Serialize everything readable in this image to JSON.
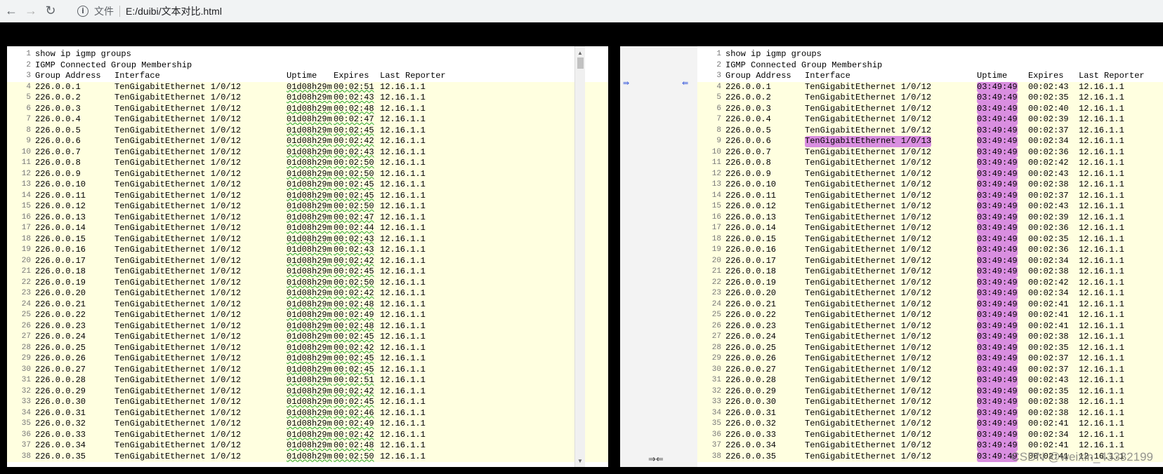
{
  "browser": {
    "file_label": "文件",
    "url": "E:/duibi/文本对比.html"
  },
  "left_pane": {
    "header_lines": [
      {
        "n": "1",
        "text": "show ip igmp groups"
      },
      {
        "n": "2",
        "text": "IGMP Connected Group Membership"
      }
    ],
    "columns": {
      "n": "3",
      "group": "Group Address",
      "iface": "Interface",
      "uptime": "Uptime",
      "expires": "Expires",
      "reporter": "Last Reporter"
    },
    "rows": [
      {
        "n": "4",
        "group": "226.0.0.1",
        "iface": "TenGigabitEthernet 1/0/12",
        "uptime": "01d08h29m",
        "expires": "00:02:51",
        "reporter": "12.16.1.1"
      },
      {
        "n": "5",
        "group": "226.0.0.2",
        "iface": "TenGigabitEthernet 1/0/12",
        "uptime": "01d08h29m",
        "expires": "00:02:43",
        "reporter": "12.16.1.1"
      },
      {
        "n": "6",
        "group": "226.0.0.3",
        "iface": "TenGigabitEthernet 1/0/12",
        "uptime": "01d08h29m",
        "expires": "00:02:48",
        "reporter": "12.16.1.1"
      },
      {
        "n": "7",
        "group": "226.0.0.4",
        "iface": "TenGigabitEthernet 1/0/12",
        "uptime": "01d08h29m",
        "expires": "00:02:47",
        "reporter": "12.16.1.1"
      },
      {
        "n": "8",
        "group": "226.0.0.5",
        "iface": "TenGigabitEthernet 1/0/12",
        "uptime": "01d08h29m",
        "expires": "00:02:45",
        "reporter": "12.16.1.1"
      },
      {
        "n": "9",
        "group": "226.0.0.6",
        "iface": "TenGigabitEthernet 1/0/12",
        "uptime": "01d08h29m",
        "expires": "00:02:42",
        "reporter": "12.16.1.1"
      },
      {
        "n": "10",
        "group": "226.0.0.7",
        "iface": "TenGigabitEthernet 1/0/12",
        "uptime": "01d08h29m",
        "expires": "00:02:43",
        "reporter": "12.16.1.1"
      },
      {
        "n": "11",
        "group": "226.0.0.8",
        "iface": "TenGigabitEthernet 1/0/12",
        "uptime": "01d08h29m",
        "expires": "00:02:50",
        "reporter": "12.16.1.1"
      },
      {
        "n": "12",
        "group": "226.0.0.9",
        "iface": "TenGigabitEthernet 1/0/12",
        "uptime": "01d08h29m",
        "expires": "00:02:50",
        "reporter": "12.16.1.1"
      },
      {
        "n": "13",
        "group": "226.0.0.10",
        "iface": "TenGigabitEthernet 1/0/12",
        "uptime": "01d08h29m",
        "expires": "00:02:45",
        "reporter": "12.16.1.1"
      },
      {
        "n": "14",
        "group": "226.0.0.11",
        "iface": "TenGigabitEthernet 1/0/12",
        "uptime": "01d08h29m",
        "expires": "00:02:45",
        "reporter": "12.16.1.1"
      },
      {
        "n": "15",
        "group": "226.0.0.12",
        "iface": "TenGigabitEthernet 1/0/12",
        "uptime": "01d08h29m",
        "expires": "00:02:50",
        "reporter": "12.16.1.1"
      },
      {
        "n": "16",
        "group": "226.0.0.13",
        "iface": "TenGigabitEthernet 1/0/12",
        "uptime": "01d08h29m",
        "expires": "00:02:47",
        "reporter": "12.16.1.1"
      },
      {
        "n": "17",
        "group": "226.0.0.14",
        "iface": "TenGigabitEthernet 1/0/12",
        "uptime": "01d08h29m",
        "expires": "00:02:44",
        "reporter": "12.16.1.1"
      },
      {
        "n": "18",
        "group": "226.0.0.15",
        "iface": "TenGigabitEthernet 1/0/12",
        "uptime": "01d08h29m",
        "expires": "00:02:43",
        "reporter": "12.16.1.1"
      },
      {
        "n": "19",
        "group": "226.0.0.16",
        "iface": "TenGigabitEthernet 1/0/12",
        "uptime": "01d08h29m",
        "expires": "00:02:43",
        "reporter": "12.16.1.1"
      },
      {
        "n": "20",
        "group": "226.0.0.17",
        "iface": "TenGigabitEthernet 1/0/12",
        "uptime": "01d08h29m",
        "expires": "00:02:42",
        "reporter": "12.16.1.1"
      },
      {
        "n": "21",
        "group": "226.0.0.18",
        "iface": "TenGigabitEthernet 1/0/12",
        "uptime": "01d08h29m",
        "expires": "00:02:45",
        "reporter": "12.16.1.1"
      },
      {
        "n": "22",
        "group": "226.0.0.19",
        "iface": "TenGigabitEthernet 1/0/12",
        "uptime": "01d08h29m",
        "expires": "00:02:50",
        "reporter": "12.16.1.1"
      },
      {
        "n": "23",
        "group": "226.0.0.20",
        "iface": "TenGigabitEthernet 1/0/12",
        "uptime": "01d08h29m",
        "expires": "00:02:42",
        "reporter": "12.16.1.1"
      },
      {
        "n": "24",
        "group": "226.0.0.21",
        "iface": "TenGigabitEthernet 1/0/12",
        "uptime": "01d08h29m",
        "expires": "00:02:48",
        "reporter": "12.16.1.1"
      },
      {
        "n": "25",
        "group": "226.0.0.22",
        "iface": "TenGigabitEthernet 1/0/12",
        "uptime": "01d08h29m",
        "expires": "00:02:49",
        "reporter": "12.16.1.1"
      },
      {
        "n": "26",
        "group": "226.0.0.23",
        "iface": "TenGigabitEthernet 1/0/12",
        "uptime": "01d08h29m",
        "expires": "00:02:48",
        "reporter": "12.16.1.1"
      },
      {
        "n": "27",
        "group": "226.0.0.24",
        "iface": "TenGigabitEthernet 1/0/12",
        "uptime": "01d08h29m",
        "expires": "00:02:45",
        "reporter": "12.16.1.1"
      },
      {
        "n": "28",
        "group": "226.0.0.25",
        "iface": "TenGigabitEthernet 1/0/12",
        "uptime": "01d08h29m",
        "expires": "00:02:42",
        "reporter": "12.16.1.1"
      },
      {
        "n": "29",
        "group": "226.0.0.26",
        "iface": "TenGigabitEthernet 1/0/12",
        "uptime": "01d08h29m",
        "expires": "00:02:45",
        "reporter": "12.16.1.1"
      },
      {
        "n": "30",
        "group": "226.0.0.27",
        "iface": "TenGigabitEthernet 1/0/12",
        "uptime": "01d08h29m",
        "expires": "00:02:45",
        "reporter": "12.16.1.1"
      },
      {
        "n": "31",
        "group": "226.0.0.28",
        "iface": "TenGigabitEthernet 1/0/12",
        "uptime": "01d08h29m",
        "expires": "00:02:51",
        "reporter": "12.16.1.1"
      },
      {
        "n": "32",
        "group": "226.0.0.29",
        "iface": "TenGigabitEthernet 1/0/12",
        "uptime": "01d08h29m",
        "expires": "00:02:42",
        "reporter": "12.16.1.1"
      },
      {
        "n": "33",
        "group": "226.0.0.30",
        "iface": "TenGigabitEthernet 1/0/12",
        "uptime": "01d08h29m",
        "expires": "00:02:45",
        "reporter": "12.16.1.1"
      },
      {
        "n": "34",
        "group": "226.0.0.31",
        "iface": "TenGigabitEthernet 1/0/12",
        "uptime": "01d08h29m",
        "expires": "00:02:46",
        "reporter": "12.16.1.1"
      },
      {
        "n": "35",
        "group": "226.0.0.32",
        "iface": "TenGigabitEthernet 1/0/12",
        "uptime": "01d08h29m",
        "expires": "00:02:49",
        "reporter": "12.16.1.1"
      },
      {
        "n": "36",
        "group": "226.0.0.33",
        "iface": "TenGigabitEthernet 1/0/12",
        "uptime": "01d08h29m",
        "expires": "00:02:42",
        "reporter": "12.16.1.1"
      },
      {
        "n": "37",
        "group": "226.0.0.34",
        "iface": "TenGigabitEthernet 1/0/12",
        "uptime": "01d08h29m",
        "expires": "00:02:48",
        "reporter": "12.16.1.1"
      },
      {
        "n": "38",
        "group": "226.0.0.35",
        "iface": "TenGigabitEthernet 1/0/12",
        "uptime": "01d08h29m",
        "expires": "00:02:50",
        "reporter": "12.16.1.1"
      }
    ]
  },
  "right_pane": {
    "header_lines": [
      {
        "n": "1",
        "text": "show ip igmp groups"
      },
      {
        "n": "2",
        "text": "IGMP Connected Group Membership"
      }
    ],
    "columns": {
      "n": "3",
      "group": "Group Address",
      "iface": "Interface",
      "uptime": "Uptime",
      "expires": "Expires",
      "reporter": "Last Reporter"
    },
    "rows": [
      {
        "n": "4",
        "group": "226.0.0.1",
        "iface": "TenGigabitEthernet 1/0/12",
        "uptime": "03:49:49",
        "expires": "00:02:43",
        "reporter": "12.16.1.1"
      },
      {
        "n": "5",
        "group": "226.0.0.2",
        "iface": "TenGigabitEthernet 1/0/12",
        "uptime": "03:49:49",
        "expires": "00:02:35",
        "reporter": "12.16.1.1"
      },
      {
        "n": "6",
        "group": "226.0.0.3",
        "iface": "TenGigabitEthernet 1/0/12",
        "uptime": "03:49:49",
        "expires": "00:02:40",
        "reporter": "12.16.1.1"
      },
      {
        "n": "7",
        "group": "226.0.0.4",
        "iface": "TenGigabitEthernet 1/0/12",
        "uptime": "03:49:49",
        "expires": "00:02:39",
        "reporter": "12.16.1.1"
      },
      {
        "n": "8",
        "group": "226.0.0.5",
        "iface": "TenGigabitEthernet 1/0/12",
        "uptime": "03:49:49",
        "expires": "00:02:37",
        "reporter": "12.16.1.1"
      },
      {
        "n": "9",
        "group": "226.0.0.6",
        "iface": "TenGigabitEthernet 1/0/13",
        "uptime": "03:49:49",
        "expires": "00:02:34",
        "reporter": "12.16.1.1"
      },
      {
        "n": "10",
        "group": "226.0.0.7",
        "iface": "TenGigabitEthernet 1/0/12",
        "uptime": "03:49:49",
        "expires": "00:02:36",
        "reporter": "12.16.1.1"
      },
      {
        "n": "11",
        "group": "226.0.0.8",
        "iface": "TenGigabitEthernet 1/0/12",
        "uptime": "03:49:49",
        "expires": "00:02:42",
        "reporter": "12.16.1.1"
      },
      {
        "n": "12",
        "group": "226.0.0.9",
        "iface": "TenGigabitEthernet 1/0/12",
        "uptime": "03:49:49",
        "expires": "00:02:43",
        "reporter": "12.16.1.1"
      },
      {
        "n": "13",
        "group": "226.0.0.10",
        "iface": "TenGigabitEthernet 1/0/12",
        "uptime": "03:49:49",
        "expires": "00:02:38",
        "reporter": "12.16.1.1"
      },
      {
        "n": "14",
        "group": "226.0.0.11",
        "iface": "TenGigabitEthernet 1/0/12",
        "uptime": "03:49:49",
        "expires": "00:02:37",
        "reporter": "12.16.1.1"
      },
      {
        "n": "15",
        "group": "226.0.0.12",
        "iface": "TenGigabitEthernet 1/0/12",
        "uptime": "03:49:49",
        "expires": "00:02:43",
        "reporter": "12.16.1.1"
      },
      {
        "n": "16",
        "group": "226.0.0.13",
        "iface": "TenGigabitEthernet 1/0/12",
        "uptime": "03:49:49",
        "expires": "00:02:39",
        "reporter": "12.16.1.1"
      },
      {
        "n": "17",
        "group": "226.0.0.14",
        "iface": "TenGigabitEthernet 1/0/12",
        "uptime": "03:49:49",
        "expires": "00:02:36",
        "reporter": "12.16.1.1"
      },
      {
        "n": "18",
        "group": "226.0.0.15",
        "iface": "TenGigabitEthernet 1/0/12",
        "uptime": "03:49:49",
        "expires": "00:02:35",
        "reporter": "12.16.1.1"
      },
      {
        "n": "19",
        "group": "226.0.0.16",
        "iface": "TenGigabitEthernet 1/0/12",
        "uptime": "03:49:49",
        "expires": "00:02:36",
        "reporter": "12.16.1.1"
      },
      {
        "n": "20",
        "group": "226.0.0.17",
        "iface": "TenGigabitEthernet 1/0/12",
        "uptime": "03:49:49",
        "expires": "00:02:34",
        "reporter": "12.16.1.1"
      },
      {
        "n": "21",
        "group": "226.0.0.18",
        "iface": "TenGigabitEthernet 1/0/12",
        "uptime": "03:49:49",
        "expires": "00:02:38",
        "reporter": "12.16.1.1"
      },
      {
        "n": "22",
        "group": "226.0.0.19",
        "iface": "TenGigabitEthernet 1/0/12",
        "uptime": "03:49:49",
        "expires": "00:02:42",
        "reporter": "12.16.1.1"
      },
      {
        "n": "23",
        "group": "226.0.0.20",
        "iface": "TenGigabitEthernet 1/0/12",
        "uptime": "03:49:49",
        "expires": "00:02:34",
        "reporter": "12.16.1.1"
      },
      {
        "n": "24",
        "group": "226.0.0.21",
        "iface": "TenGigabitEthernet 1/0/12",
        "uptime": "03:49:49",
        "expires": "00:02:41",
        "reporter": "12.16.1.1"
      },
      {
        "n": "25",
        "group": "226.0.0.22",
        "iface": "TenGigabitEthernet 1/0/12",
        "uptime": "03:49:49",
        "expires": "00:02:41",
        "reporter": "12.16.1.1"
      },
      {
        "n": "26",
        "group": "226.0.0.23",
        "iface": "TenGigabitEthernet 1/0/12",
        "uptime": "03:49:49",
        "expires": "00:02:41",
        "reporter": "12.16.1.1"
      },
      {
        "n": "27",
        "group": "226.0.0.24",
        "iface": "TenGigabitEthernet 1/0/12",
        "uptime": "03:49:49",
        "expires": "00:02:38",
        "reporter": "12.16.1.1"
      },
      {
        "n": "28",
        "group": "226.0.0.25",
        "iface": "TenGigabitEthernet 1/0/12",
        "uptime": "03:49:49",
        "expires": "00:02:35",
        "reporter": "12.16.1.1"
      },
      {
        "n": "29",
        "group": "226.0.0.26",
        "iface": "TenGigabitEthernet 1/0/12",
        "uptime": "03:49:49",
        "expires": "00:02:37",
        "reporter": "12.16.1.1"
      },
      {
        "n": "30",
        "group": "226.0.0.27",
        "iface": "TenGigabitEthernet 1/0/12",
        "uptime": "03:49:49",
        "expires": "00:02:37",
        "reporter": "12.16.1.1"
      },
      {
        "n": "31",
        "group": "226.0.0.28",
        "iface": "TenGigabitEthernet 1/0/12",
        "uptime": "03:49:49",
        "expires": "00:02:43",
        "reporter": "12.16.1.1"
      },
      {
        "n": "32",
        "group": "226.0.0.29",
        "iface": "TenGigabitEthernet 1/0/12",
        "uptime": "03:49:49",
        "expires": "00:02:35",
        "reporter": "12.16.1.1"
      },
      {
        "n": "33",
        "group": "226.0.0.30",
        "iface": "TenGigabitEthernet 1/0/12",
        "uptime": "03:49:49",
        "expires": "00:02:38",
        "reporter": "12.16.1.1"
      },
      {
        "n": "34",
        "group": "226.0.0.31",
        "iface": "TenGigabitEthernet 1/0/12",
        "uptime": "03:49:49",
        "expires": "00:02:38",
        "reporter": "12.16.1.1"
      },
      {
        "n": "35",
        "group": "226.0.0.32",
        "iface": "TenGigabitEthernet 1/0/12",
        "uptime": "03:49:49",
        "expires": "00:02:41",
        "reporter": "12.16.1.1"
      },
      {
        "n": "36",
        "group": "226.0.0.33",
        "iface": "TenGigabitEthernet 1/0/12",
        "uptime": "03:49:49",
        "expires": "00:02:34",
        "reporter": "12.16.1.1"
      },
      {
        "n": "37",
        "group": "226.0.0.34",
        "iface": "TenGigabitEthernet 1/0/12",
        "uptime": "03:49:49",
        "expires": "00:02:41",
        "reporter": "12.16.1.1"
      },
      {
        "n": "38",
        "group": "226.0.0.35",
        "iface": "TenGigabitEthernet 1/0/12",
        "uptime": "03:49:49",
        "expires": "00:02:41",
        "reporter": "12.16.1.1"
      }
    ]
  },
  "gutter": {
    "copy_right_arrow": "⇛",
    "copy_left_arrow": "⇚",
    "merge_arrows": "⇒⇐"
  },
  "watermark": "CSDN @weixin_43332199",
  "colors": {
    "changed_line_bg": "#ffffe0",
    "diff_highlight": "#d98ee0",
    "squiggle": "#26a826"
  }
}
